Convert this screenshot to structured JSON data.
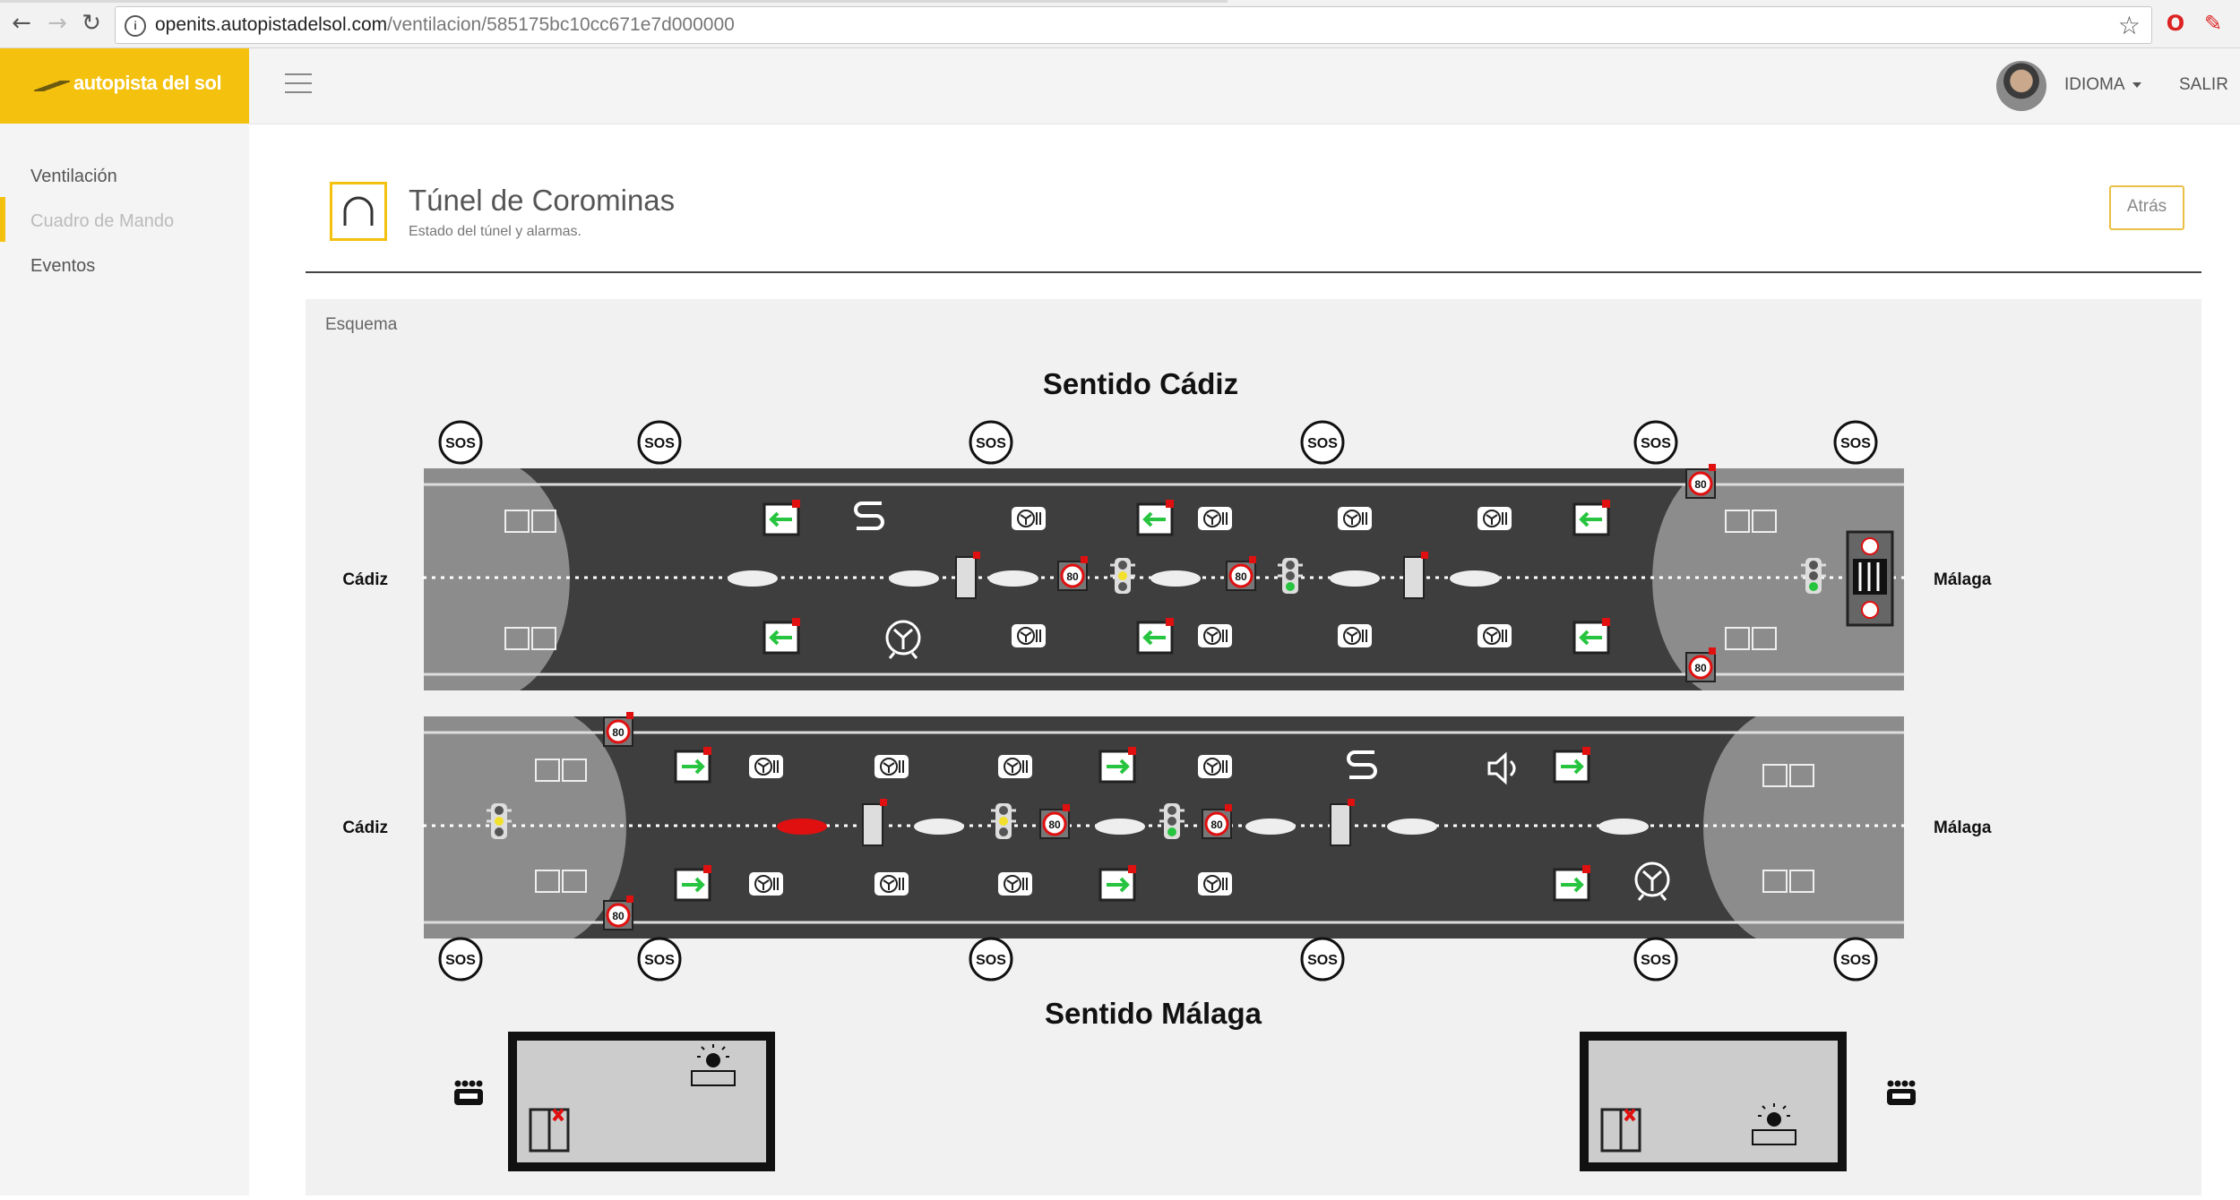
{
  "browser": {
    "url_host": "openits.autopistadelsol.com",
    "url_path": "/ventilacion/585175bc10cc671e7d000000"
  },
  "brand": {
    "logo_text": "autopista del sol",
    "accent": "#f4c10e"
  },
  "header": {
    "language_label": "IDIOMA",
    "logout_label": "SALIR"
  },
  "sidebar": {
    "items": [
      {
        "label": "Ventilación",
        "active": false
      },
      {
        "label": "Cuadro de Mando",
        "active": true
      },
      {
        "label": "Eventos",
        "active": false
      }
    ]
  },
  "page": {
    "title": "Túnel de Corominas",
    "subtitle": "Estado del túnel y alarmas.",
    "back_label": "Atrás"
  },
  "panel": {
    "label": "Esquema"
  },
  "schema": {
    "direction_top": "Sentido Cádiz",
    "direction_bottom": "Sentido Málaga",
    "left_end": "Cádiz",
    "right_end": "Málaga",
    "sos_label": "SOS",
    "speed_label": "80",
    "colors": {
      "road": "#3e3e3e",
      "portal": "#8c8c8c",
      "green": "#27c43f",
      "red": "#e01010",
      "yellow": "#f2e02c"
    }
  }
}
